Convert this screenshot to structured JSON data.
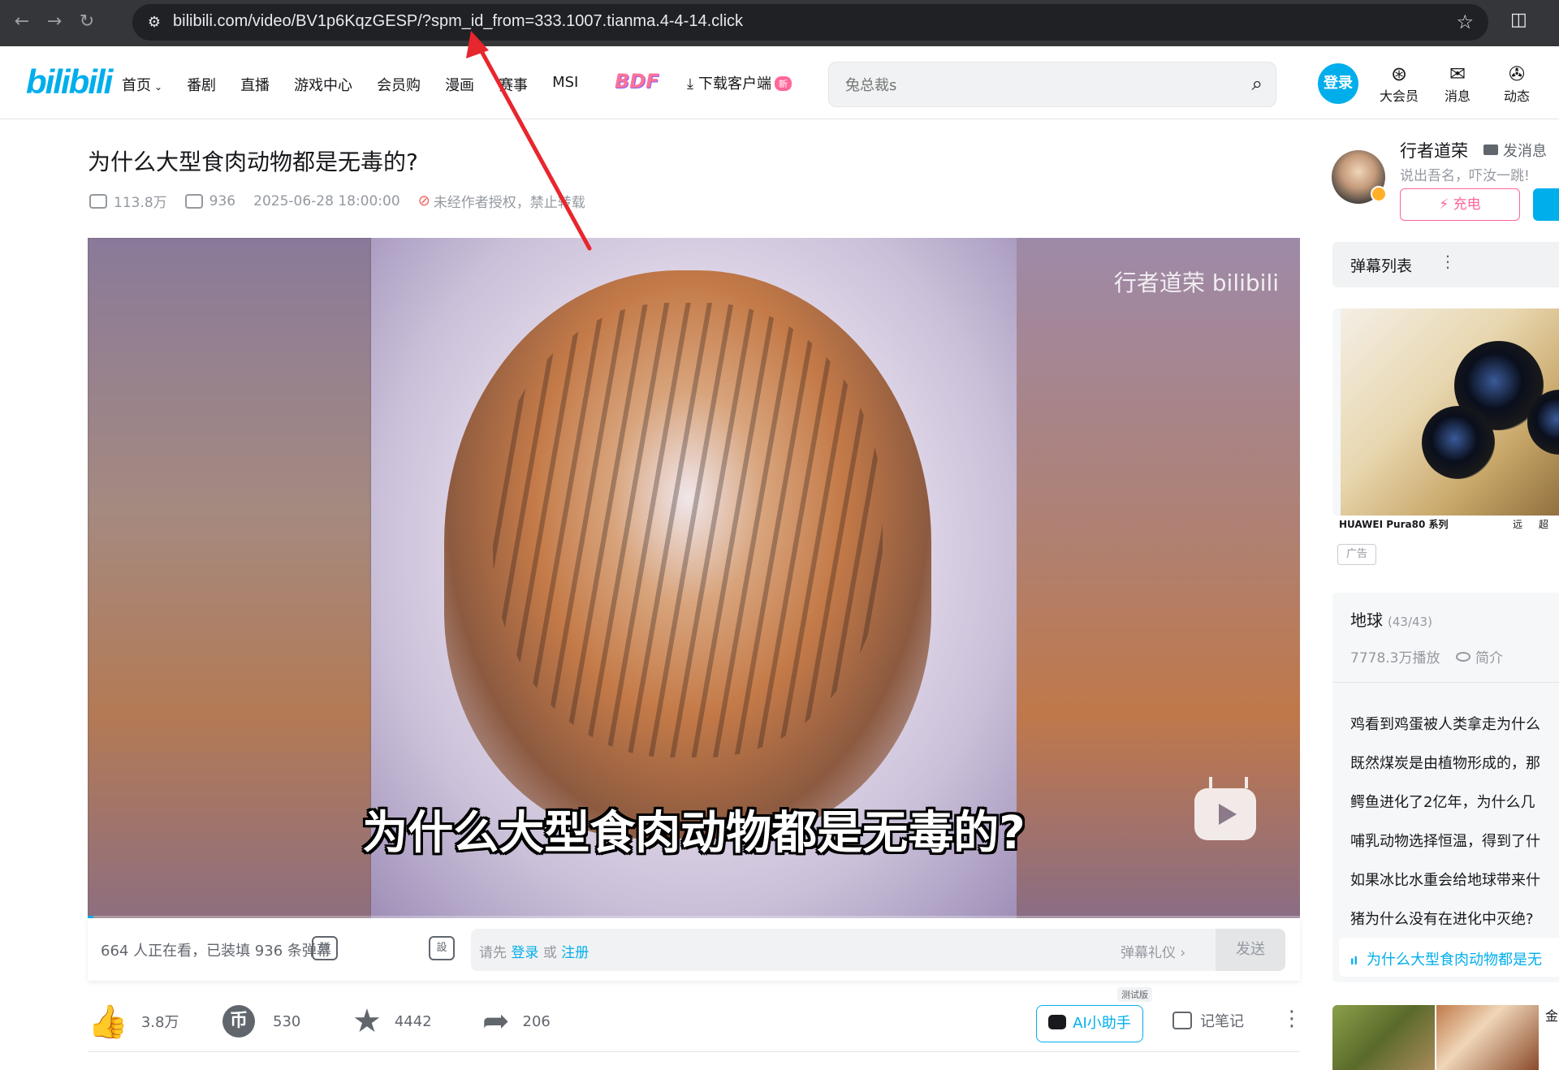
{
  "browser": {
    "url": "bilibili.com/video/BV1p6KqzGESP/?spm_id_from=333.1007.tianma.4-4-14.click",
    "back_glyph": "←",
    "forward_glyph": "→",
    "reload_glyph": "↻",
    "site_info_glyph": "⚙",
    "star_glyph": "☆",
    "ext_glyph": "◫"
  },
  "header": {
    "logo": "bilibili",
    "nav": [
      {
        "label": "首页",
        "has_caret": true
      },
      {
        "label": "番剧"
      },
      {
        "label": "直播"
      },
      {
        "label": "游戏中心"
      },
      {
        "label": "会员购"
      },
      {
        "label": "漫画"
      },
      {
        "label": "赛事"
      },
      {
        "label": "MSI"
      }
    ],
    "nav_caret": "⌄",
    "bdf_logo": "BDF",
    "download": {
      "label": "下载客户端",
      "badge": "新",
      "icon": "⤓"
    },
    "search": {
      "value": "",
      "placeholder": "兔总裁s",
      "icon": "⌕"
    },
    "login": "登录",
    "icons": [
      {
        "label": "大会员",
        "glyph": "⊛"
      },
      {
        "label": "消息",
        "glyph": "✉"
      },
      {
        "label": "动态",
        "glyph": "✇"
      }
    ]
  },
  "video": {
    "title": "为什么大型食肉动物都是无毒的?",
    "views": "113.8万",
    "danmaku_count": "936",
    "date": "2025-06-28 18:00:00",
    "copyright": "未经作者授权，禁止转载",
    "ban_icon": "⊘",
    "watermark": "行者道荣 bilibili",
    "subtitle": "为什么大型食肉动物都是无毒的?",
    "progress": 0.005
  },
  "danmaku_bar": {
    "watching": "664 人正在看，已装填 936 条弹幕",
    "toggle_label": "弹",
    "settings_label": "設",
    "prompt_prefix": "请先",
    "login_link": "登录",
    "or": "或",
    "register_link": "注册",
    "etiquette": "弹幕礼仪 ›",
    "send": "发送"
  },
  "toolbar": {
    "like_glyph": "👍",
    "like": "3.8万",
    "coin_glyph": "币",
    "coin": "530",
    "fav_glyph": "★",
    "fav": "4442",
    "share_glyph": "➦",
    "share": "206",
    "ai_label": "AI小助手",
    "ai_badge": "测试版",
    "note": "记笔记",
    "more": "⋮"
  },
  "uploader": {
    "name": "行者道荣",
    "message": "发消息",
    "sign": "说出吾名，吓汝一跳!",
    "charge": "⚡ 充电"
  },
  "sidebar": {
    "danmaku_list": "弹幕列表",
    "danmaku_dots": "⋮",
    "ad_brand": "HUAWEI Pura80 系列",
    "ad_slogan": "远 超 所",
    "ad_tag": "广告",
    "playlist": {
      "title": "地球",
      "count": "(43/43)",
      "plays": "7778.3万播放",
      "intro": "简介",
      "episodes": [
        "鸡看到鸡蛋被人类拿走为什么",
        "既然煤炭是由植物形成的，那",
        "鳄鱼进化了2亿年，为什么几",
        "哺乳动物选择恒温，得到了什",
        "如果冰比水重会给地球带来什",
        "猪为什么没有在进化中灭绝?"
      ],
      "active": "为什么大型食肉动物都是无",
      "active_marker": "ıl"
    },
    "bottom_card_text": "金"
  },
  "colors": {
    "brand": "#00aeec",
    "pink": "#ff6699",
    "arrow": "#e8262d"
  }
}
